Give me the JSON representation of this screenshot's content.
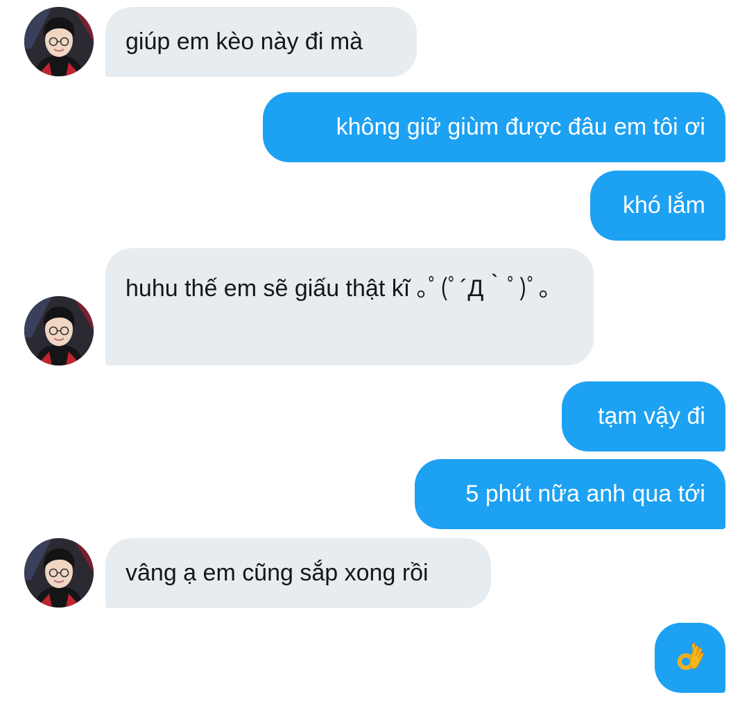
{
  "conversation": {
    "messages": [
      {
        "sender": "other",
        "text": "giúp em kèo này đi mà"
      },
      {
        "sender": "me",
        "text": "không giữ giùm được đâu em tôi ơi"
      },
      {
        "sender": "me",
        "text": "khó lắm"
      },
      {
        "sender": "other",
        "text": "huhu thế em sẽ giấu thật kĩ ｡ﾟ(ﾟ´Д｀ﾟ)ﾟ｡"
      },
      {
        "sender": "me",
        "text": "tạm vậy đi"
      },
      {
        "sender": "me",
        "text": "5 phút nữa anh qua tới"
      },
      {
        "sender": "other",
        "text": "vâng ạ em cũng sắp xong rồi"
      },
      {
        "sender": "me",
        "emoji": "ok-hand-icon"
      }
    ]
  },
  "colors": {
    "incoming_bubble": "#e6ecf0",
    "incoming_text": "#14171a",
    "outgoing_bubble": "#1da1f2",
    "outgoing_text": "#ffffff"
  }
}
